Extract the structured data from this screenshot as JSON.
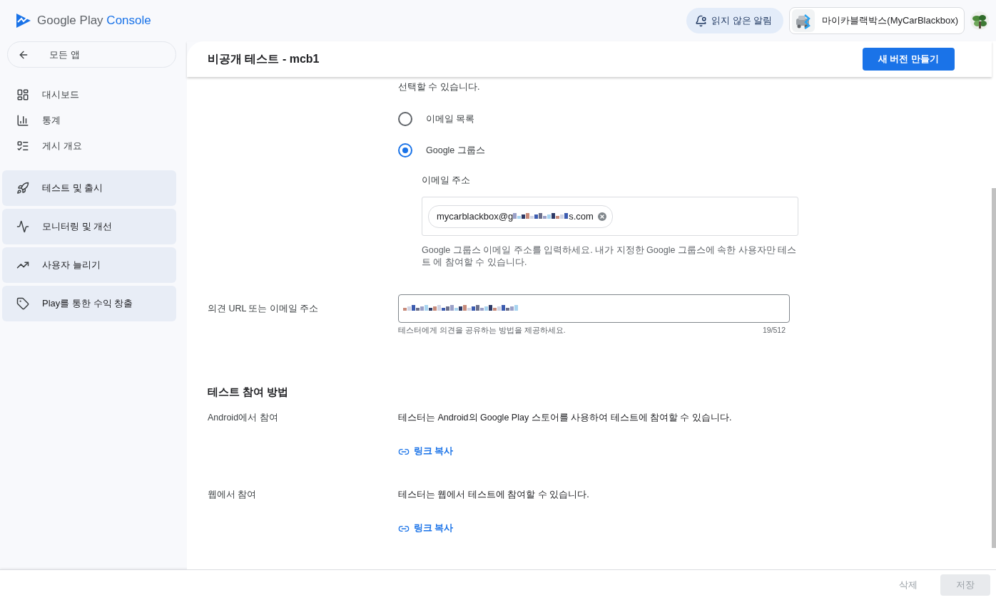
{
  "topbar": {
    "brand": "Google Play",
    "brand_suffix": "Console",
    "notifications": "읽지 않은 알림",
    "app_name": "마이카블랙박스(MyCarBlackbox)"
  },
  "sidebar": {
    "back": "모든 앱",
    "items": [
      {
        "label": "대시보드",
        "kind": "link"
      },
      {
        "label": "통계",
        "kind": "link"
      },
      {
        "label": "게시 개요",
        "kind": "link"
      },
      {
        "label": "테스트 및 출시",
        "kind": "section"
      },
      {
        "label": "모니터링 및 개선",
        "kind": "section"
      },
      {
        "label": "사용자 늘리기",
        "kind": "section"
      },
      {
        "label": "Play를 통한 수익 창출",
        "kind": "section"
      }
    ]
  },
  "page": {
    "title": "비공개 테스트 - mcb1",
    "primary_button": "새 버전 만들기"
  },
  "testers": {
    "note": "선택할 수 있습니다.",
    "options": [
      {
        "label": "이메일 목록",
        "selected": false
      },
      {
        "label": "Google 그룹스",
        "selected": true
      }
    ],
    "email_label": "이메일 주소",
    "chips": [
      {
        "text_start": "mycarblackbox@g",
        "text_end": "s.com"
      }
    ],
    "help": "Google 그룹스 이메일 주소를 입력하세요. 내가 지정한 Google 그룹스에 속한 사용자만 테스트 에 참여할 수 있습니다."
  },
  "feedback": {
    "label": "의견 URL 또는 이메일 주소",
    "helper": "테스터에게 의견을 공유하는 방법을 제공하세요.",
    "counter": "19/512"
  },
  "join": {
    "title": "테스트 참여 방법",
    "rows": [
      {
        "label": "Android에서 참여",
        "description": "테스터는 Android의 Google Play 스토어를 사용하여 테스트에 참여할 수 있습니다.",
        "link": "링크 복사"
      },
      {
        "label": "웹에서 참여",
        "description": "테스터는 웹에서 테스트에 참여할 수 있습니다.",
        "link": "링크 복사"
      }
    ]
  },
  "footer": {
    "buttons": [
      {
        "label": "삭제",
        "kind": "text",
        "disabled": true
      },
      {
        "label": "저장",
        "kind": "filled",
        "disabled": true
      }
    ]
  }
}
